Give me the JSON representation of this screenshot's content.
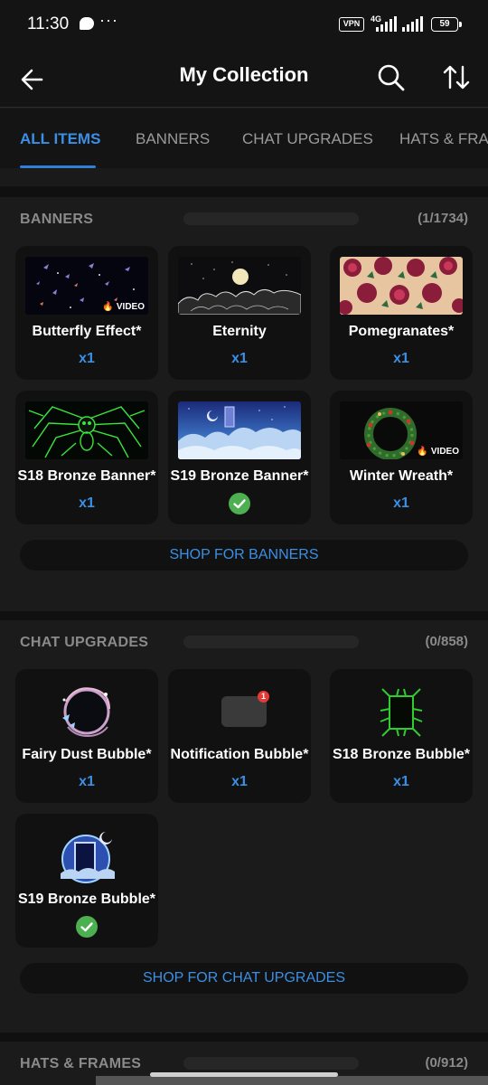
{
  "status_bar": {
    "time": "11:30",
    "dots": "···",
    "vpn": "VPN",
    "network": "4G",
    "battery": "59"
  },
  "header": {
    "title": "My Collection"
  },
  "tabs": [
    {
      "label": "ALL ITEMS",
      "active": true
    },
    {
      "label": "BANNERS"
    },
    {
      "label": "CHAT UPGRADES"
    },
    {
      "label": "HATS & FRAMES"
    }
  ],
  "banners": {
    "title": "BANNERS",
    "count": "(1/1734)",
    "items": [
      {
        "name": "Butterfly Effect*",
        "qty": "x1",
        "badge": "VIDEO"
      },
      {
        "name": "Eternity",
        "qty": "x1"
      },
      {
        "name": "Pomegranates*",
        "qty": "x1"
      },
      {
        "name": "S18 Bronze Banner*",
        "qty": "x1"
      },
      {
        "name": "S19 Bronze Banner*",
        "qty": "",
        "owned": true
      },
      {
        "name": "Winter Wreath*",
        "qty": "x1",
        "badge": "VIDEO"
      }
    ],
    "shop_label": "SHOP FOR BANNERS"
  },
  "chat_upgrades": {
    "title": "CHAT UPGRADES",
    "count": "(0/858)",
    "items": [
      {
        "name": "Fairy Dust Bubble*",
        "qty": "x1"
      },
      {
        "name": "Notification Bubble*",
        "qty": "x1",
        "notif": "1"
      },
      {
        "name": "S18 Bronze Bubble*",
        "qty": "x1"
      },
      {
        "name": "S19 Bronze Bubble*",
        "qty": "",
        "owned": true
      }
    ],
    "shop_label": "SHOP FOR CHAT UPGRADES"
  },
  "hats_frames": {
    "title": "HATS & FRAMES",
    "count": "(0/912)"
  },
  "colors": {
    "accent": "#3b8fe4",
    "owned_check": "#4caf50",
    "background": "#1b1b1b",
    "card": "#111111"
  }
}
